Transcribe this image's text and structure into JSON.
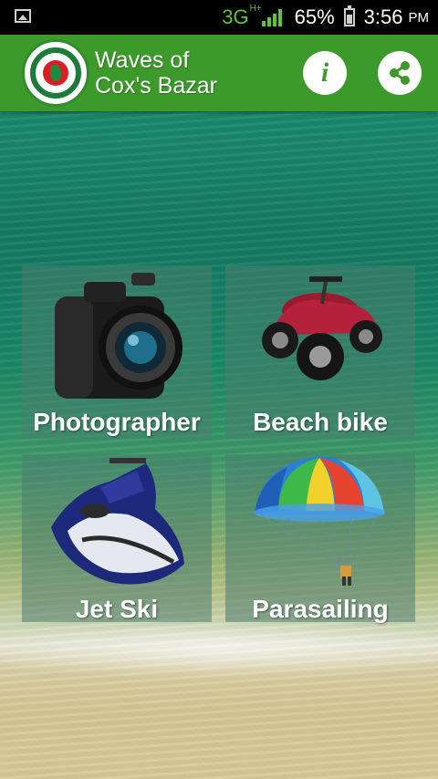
{
  "status_bar": {
    "network": "3G",
    "network_sup": "H+",
    "battery_percent": "65%",
    "time": "3:56",
    "ampm": "PM"
  },
  "app_bar": {
    "title_line1": "Waves of",
    "title_line2": "Cox's Bazar",
    "info_glyph": "i",
    "logo_icon": "bangladesh-government-seal"
  },
  "tiles": [
    {
      "label": "Photographer",
      "icon": "camera-icon"
    },
    {
      "label": "Beach bike",
      "icon": "atv-icon"
    },
    {
      "label": "Jet Ski",
      "icon": "jet-ski-icon"
    },
    {
      "label": "Parasailing",
      "icon": "parachute-icon"
    }
  ],
  "colors": {
    "app_bar": "#3c9a2a",
    "status_bar": "#000000",
    "network_green": "#5cc53a"
  }
}
